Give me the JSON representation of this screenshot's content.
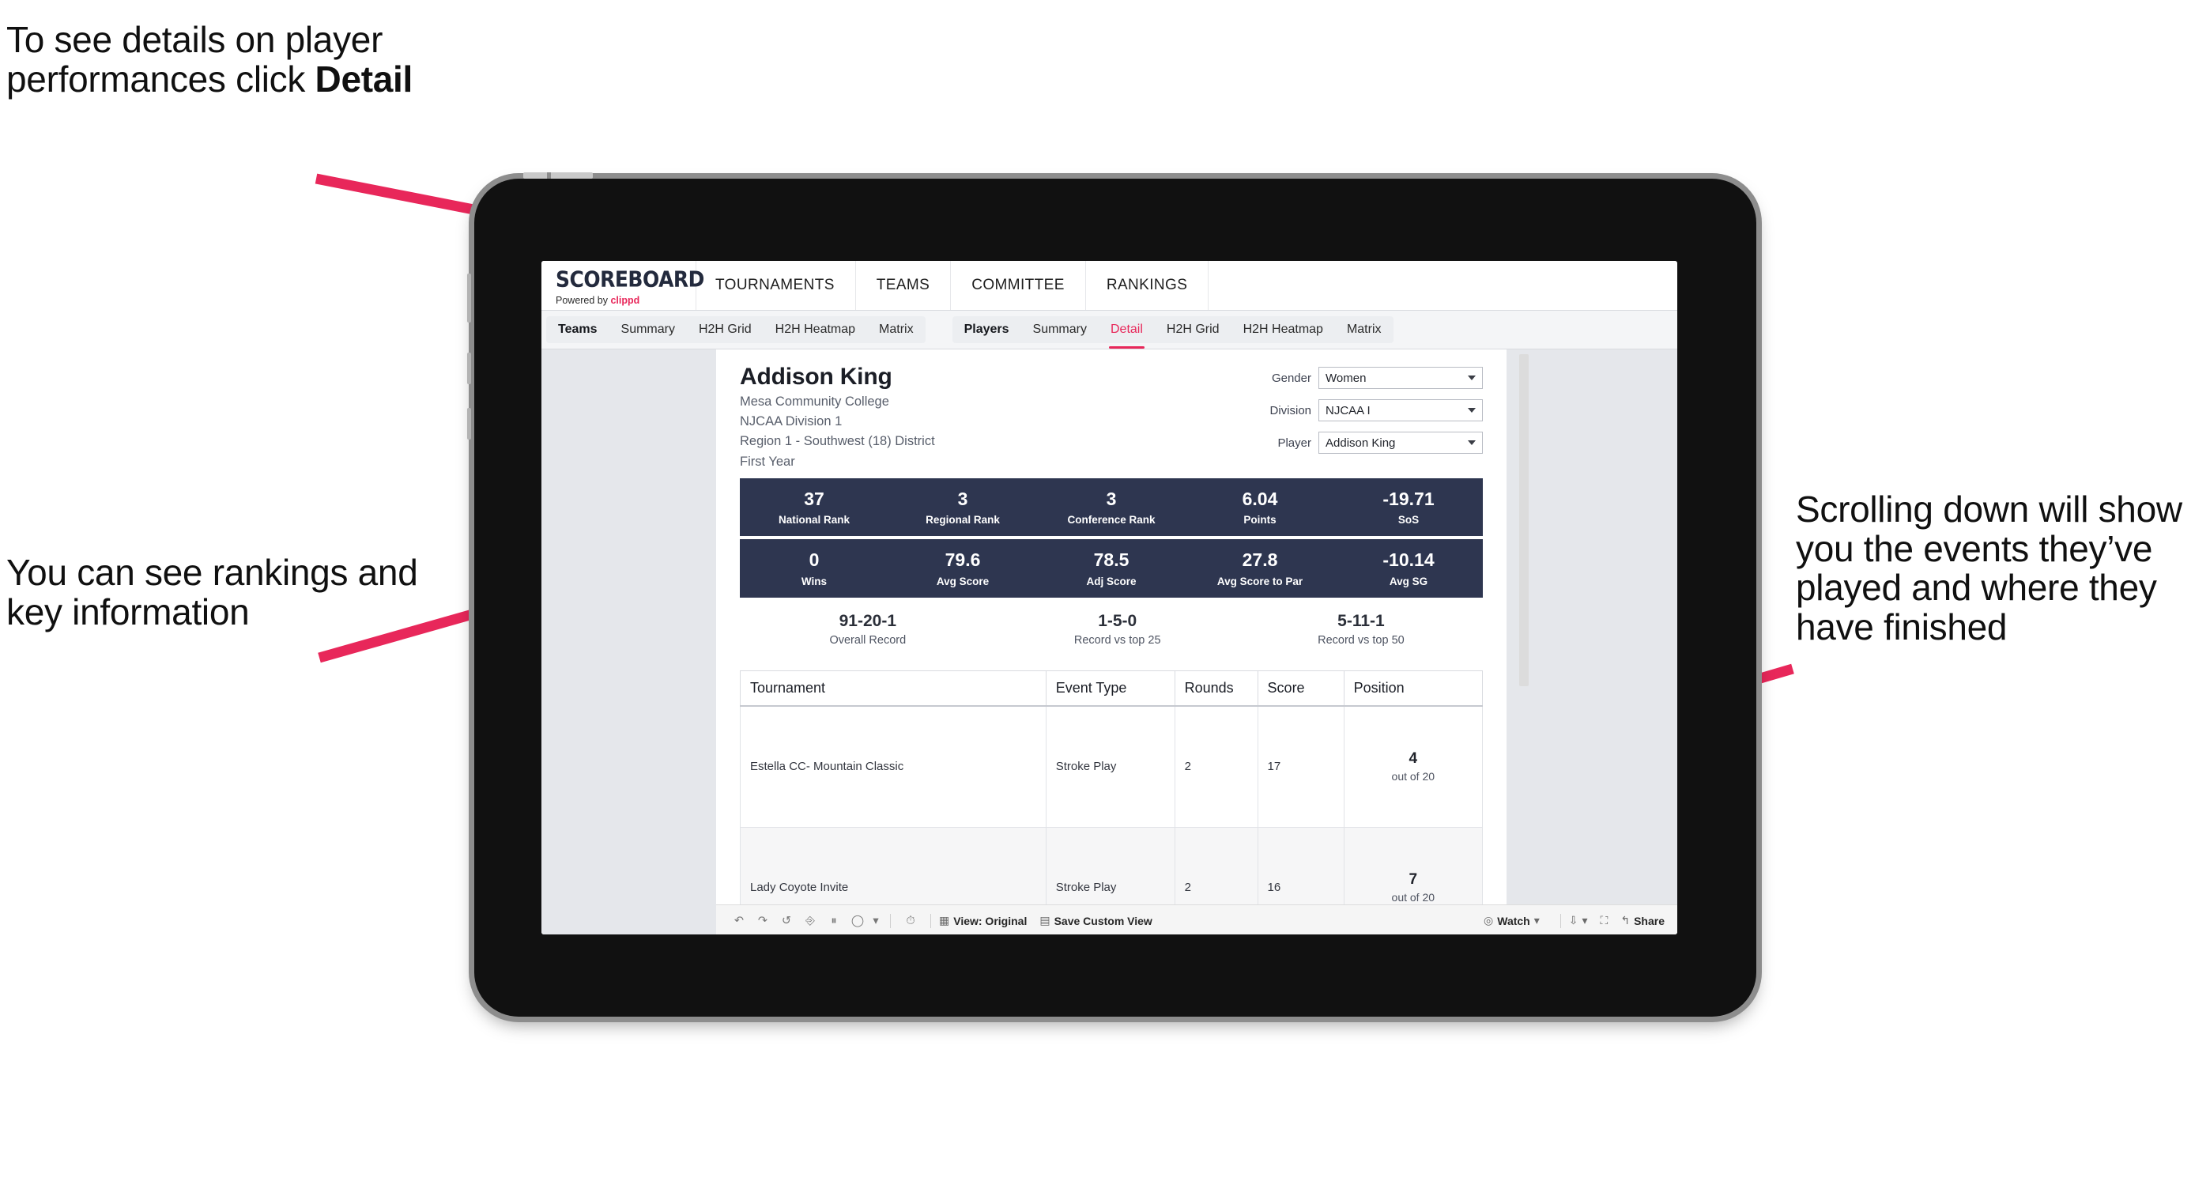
{
  "annotations": {
    "top_left": "To see details on player performances click ",
    "top_left_bold": "Detail",
    "mid_left": "You can see rankings and key information",
    "right": "Scrolling down will show you the events they’ve played and where they have finished",
    "arrow_color": "#e8275a"
  },
  "app": {
    "logo": {
      "title": "SCOREBOARD",
      "powered_prefix": "Powered by ",
      "brand": "clippd"
    },
    "main_nav": [
      "TOURNAMENTS",
      "TEAMS",
      "COMMITTEE",
      "RANKINGS"
    ],
    "tab_groups": [
      {
        "head": "Teams",
        "tabs": [
          "Summary",
          "H2H Grid",
          "H2H Heatmap",
          "Matrix"
        ],
        "active": ""
      },
      {
        "head": "Players",
        "tabs": [
          "Summary",
          "Detail",
          "H2H Grid",
          "H2H Heatmap",
          "Matrix"
        ],
        "active": "Detail"
      }
    ],
    "player": {
      "name": "Addison King",
      "school": "Mesa Community College",
      "division": "NJCAA Division 1",
      "region": "Region 1 - Southwest (18) District",
      "year": "First Year"
    },
    "filters": [
      {
        "label": "Gender",
        "value": "Women"
      },
      {
        "label": "Division",
        "value": "NJCAA I"
      },
      {
        "label": "Player",
        "value": "Addison King"
      }
    ],
    "stats_band_1": [
      {
        "value": "37",
        "label": "National Rank"
      },
      {
        "value": "3",
        "label": "Regional Rank"
      },
      {
        "value": "3",
        "label": "Conference Rank"
      },
      {
        "value": "6.04",
        "label": "Points"
      },
      {
        "value": "-19.71",
        "label": "SoS"
      }
    ],
    "stats_band_2": [
      {
        "value": "0",
        "label": "Wins"
      },
      {
        "value": "79.6",
        "label": "Avg Score"
      },
      {
        "value": "78.5",
        "label": "Adj Score"
      },
      {
        "value": "27.8",
        "label": "Avg Score to Par"
      },
      {
        "value": "-10.14",
        "label": "Avg SG"
      }
    ],
    "records": [
      {
        "value": "91-20-1",
        "label": "Overall Record"
      },
      {
        "value": "1-5-0",
        "label": "Record vs top 25"
      },
      {
        "value": "5-11-1",
        "label": "Record vs top 50"
      }
    ],
    "table": {
      "columns": [
        "Tournament",
        "Event Type",
        "Rounds",
        "Score",
        "Position"
      ],
      "rows": [
        {
          "tournament": "Estella CC- Mountain Classic",
          "event_type": "Stroke Play",
          "rounds": "2",
          "score": "17",
          "position": "4",
          "position_of": "out of 20"
        },
        {
          "tournament": "Lady Coyote Invite",
          "event_type": "Stroke Play",
          "rounds": "2",
          "score": "16",
          "position": "7",
          "position_of": "out of 20"
        }
      ]
    },
    "toolbar": {
      "view_label": "View: Original",
      "save_label": "Save Custom View",
      "watch_label": "Watch",
      "share_label": "Share"
    },
    "colors": {
      "accent": "#e8275a",
      "band": "#2e3650",
      "screen_bg": "#e5e7eb"
    }
  }
}
